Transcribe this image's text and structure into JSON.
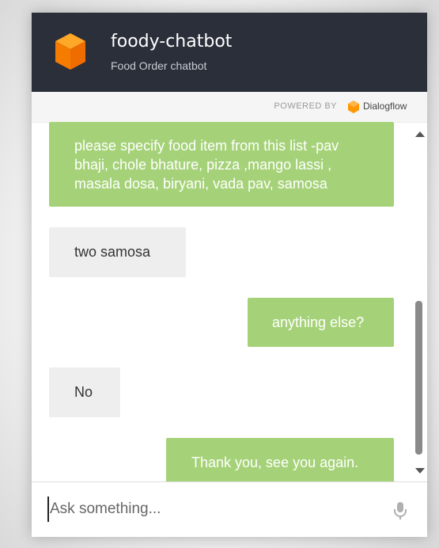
{
  "header": {
    "title": "foody-chatbot",
    "subtitle": "Food Order chatbot"
  },
  "powered_by": {
    "label": "POWERED BY",
    "brand": "Dialogflow"
  },
  "messages": [
    {
      "role": "bot",
      "text": "please specify food item from this list -pav bhaji, chole bhature, pizza ,mango lassi , masala dosa, biryani, vada pav, samosa"
    },
    {
      "role": "user",
      "text": "two samosa"
    },
    {
      "role": "bot",
      "text": "anything else?"
    },
    {
      "role": "user",
      "text": "No"
    },
    {
      "role": "bot",
      "text": "Thank you, see you again."
    }
  ],
  "input": {
    "placeholder": "Ask something..."
  },
  "colors": {
    "header_bg": "#2b2f3a",
    "bot_bubble": "#a5d278",
    "user_bubble": "#eeeeee",
    "logo_orange": "#f57c00"
  },
  "icons": {
    "logo": "orange-cube-icon",
    "brand": "dialogflow-icon",
    "mic": "microphone-icon"
  }
}
